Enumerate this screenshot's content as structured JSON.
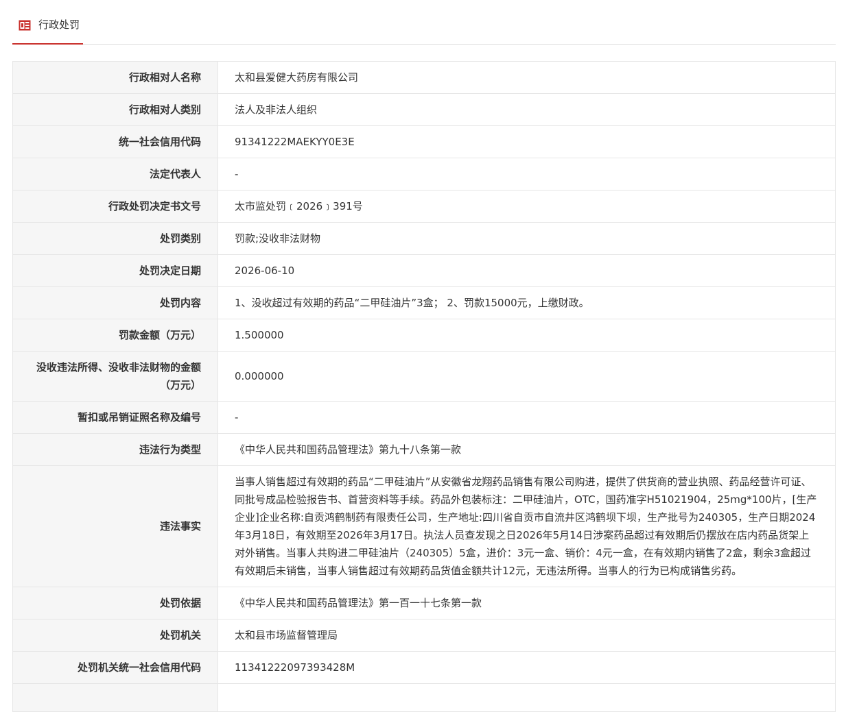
{
  "tab": {
    "label": "行政处罚",
    "icon": "document-icon",
    "accent_color": "#c9302c"
  },
  "fields": [
    {
      "label": "行政相对人名称",
      "value": "太和县爱健大药房有限公司"
    },
    {
      "label": "行政相对人类别",
      "value": "法人及非法人组织"
    },
    {
      "label": "统一社会信用代码",
      "value": "91341222MAEKYY0E3E"
    },
    {
      "label": "法定代表人",
      "value": "-"
    },
    {
      "label": "行政处罚决定书文号",
      "value": "太市监处罚﹝2026﹞391号"
    },
    {
      "label": "处罚类别",
      "value": "罚款;没收非法财物"
    },
    {
      "label": "处罚决定日期",
      "value": "2026-06-10"
    },
    {
      "label": "处罚内容",
      "value": "1、没收超过有效期的药品“二甲硅油片”3盒； 2、罚款15000元，上缴财政。"
    },
    {
      "label": "罚款金额（万元）",
      "value": "1.500000"
    },
    {
      "label": "没收违法所得、没收非法财物的金额（万元）",
      "value": "0.000000"
    },
    {
      "label": "暂扣或吊销证照名称及编号",
      "value": "-"
    },
    {
      "label": "违法行为类型",
      "value": "《中华人民共和国药品管理法》第九十八条第一款"
    },
    {
      "label": "违法事实",
      "value": "当事人销售超过有效期的药品“二甲硅油片”从安徽省龙翔药品销售有限公司购进，提供了供货商的营业执照、药品经营许可证、同批号成品检验报告书、首营资料等手续。药品外包装标注：二甲硅油片，OTC，国药准字H51021904，25mg*100片，[生产企业]企业名称:自贡鸿鹤制药有限责任公司，生产地址:四川省自贡市自流井区鸿鹤坝下坝，生产批号为240305，生产日期2024年3月18日，有效期至2026年3月17日。执法人员查发现之日2026年5月14日涉案药品超过有效期后仍摆放在店内药品货架上对外销售。当事人共购进二甲硅油片（240305）5盒，进价：3元一盒、销价：4元一盒，在有效期内销售了2盒，剩余3盒超过有效期后未销售，当事人销售超过有效期药品货值金额共计12元，无违法所得。当事人的行为已构成销售劣药。"
    },
    {
      "label": "处罚依据",
      "value": "《中华人民共和国药品管理法》第一百一十七条第一款"
    },
    {
      "label": "处罚机关",
      "value": "太和县市场监督管理局"
    },
    {
      "label": "处罚机关统一社会信用代码",
      "value": "11341222097393428M"
    },
    {
      "label": "",
      "value": ""
    }
  ]
}
